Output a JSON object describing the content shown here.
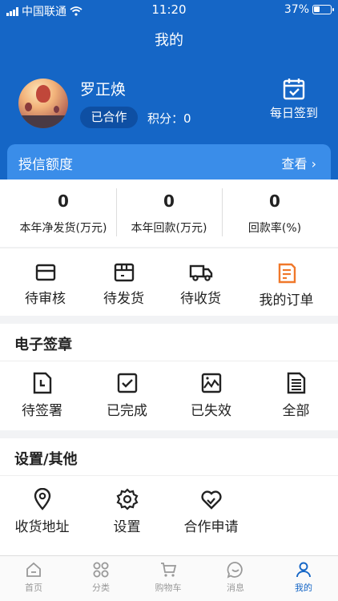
{
  "status_bar": {
    "carrier": "中国联通",
    "time": "11:20",
    "battery": "37%",
    "battery_level": 0.37
  },
  "header": {
    "title": "我的"
  },
  "profile": {
    "name": "罗正焕",
    "badge": "已合作",
    "points": "积分：0",
    "checkin_label": "每日签到"
  },
  "credit": {
    "title": "授信额度",
    "view_label": "查看"
  },
  "stats": [
    {
      "value": "0",
      "label": "本年净发货(万元)"
    },
    {
      "value": "0",
      "label": "本年回款(万元)"
    },
    {
      "value": "0",
      "label": "回款率(%)"
    }
  ],
  "orders": [
    {
      "label": "待审核",
      "icon": "card-icon"
    },
    {
      "label": "待发货",
      "icon": "box-icon"
    },
    {
      "label": "待收货",
      "icon": "truck-icon"
    },
    {
      "label": "我的订单",
      "icon": "order-document-icon"
    }
  ],
  "esign": {
    "title": "电子签章",
    "items": [
      {
        "label": "待签署",
        "icon": "document-clock-icon"
      },
      {
        "label": "已完成",
        "icon": "checkbox-icon"
      },
      {
        "label": "已失效",
        "icon": "broken-image-icon"
      },
      {
        "label": "全部",
        "icon": "document-list-icon"
      }
    ]
  },
  "settings": {
    "title": "设置/其他",
    "items": [
      {
        "label": "收货地址",
        "icon": "location-pin-icon"
      },
      {
        "label": "设置",
        "icon": "gear-icon"
      },
      {
        "label": "合作申请",
        "icon": "heart-link-icon"
      }
    ]
  },
  "tabbar": {
    "items": [
      {
        "label": "首页",
        "icon": "home-icon"
      },
      {
        "label": "分类",
        "icon": "category-grid-icon"
      },
      {
        "label": "购物车",
        "icon": "cart-icon"
      },
      {
        "label": "消息",
        "icon": "chat-icon"
      },
      {
        "label": "我的",
        "icon": "user-icon"
      }
    ],
    "active": "我的"
  },
  "colors": {
    "primary": "#1566c6",
    "credit_bar": "#3a8de9",
    "orange_icon": "#f0782a"
  }
}
